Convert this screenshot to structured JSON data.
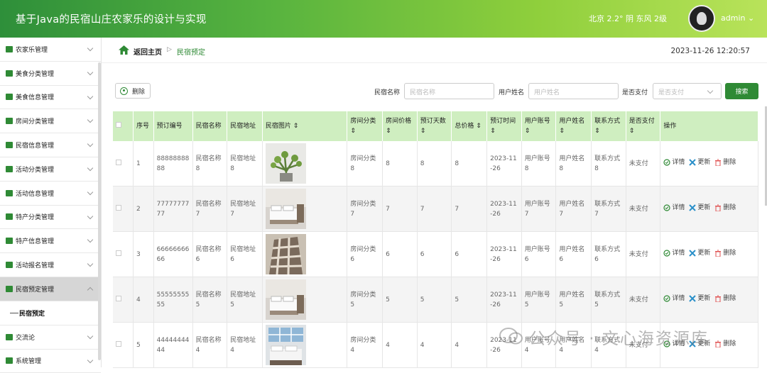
{
  "header": {
    "title": "基于Java的民宿山庄农家乐的设计与实现",
    "weather": "北京 2.2° 阴 东风 2级",
    "user": "admin ⌄"
  },
  "sidebar": {
    "items": [
      {
        "label": "农家乐管理",
        "icon": "check-icon"
      },
      {
        "label": "美食分类管理",
        "icon": "grid-icon"
      },
      {
        "label": "美食信息管理",
        "icon": "grid-icon"
      },
      {
        "label": "房间分类管理",
        "icon": "flag-icon"
      },
      {
        "label": "民宿信息管理",
        "icon": "chat-icon"
      },
      {
        "label": "活动分类管理",
        "icon": "card-icon"
      },
      {
        "label": "活动信息管理",
        "icon": "grid-icon"
      },
      {
        "label": "特产分类管理",
        "icon": "person-icon"
      },
      {
        "label": "特产信息管理",
        "icon": "pen-icon"
      },
      {
        "label": "活动报名管理",
        "icon": "grid-icon"
      },
      {
        "label": "民宿预定管理",
        "icon": "grid-icon",
        "open": true
      },
      {
        "label": "交流论",
        "icon": "chat-icon"
      },
      {
        "label": "系统管理",
        "icon": "grid-icon"
      }
    ],
    "sub_item": "民宿预定"
  },
  "breadcrumb": {
    "home": "返回主页",
    "sep": "▷",
    "current": "民宿预定"
  },
  "clock": "2023-11-26 12:20:57",
  "toolbar": {
    "delete": "删除",
    "search": "搜索"
  },
  "filters": [
    {
      "label": "民宿名称",
      "placeholder": "民宿名称"
    },
    {
      "label": "用户姓名",
      "placeholder": "用户姓名"
    },
    {
      "label": "是否支付",
      "placeholder": "是否支付"
    }
  ],
  "table": {
    "columns": [
      "",
      "序号",
      "预订编号",
      "民宿名称",
      "民宿地址",
      "民宿图片 ⇕",
      "房间分类 ⇕",
      "房间价格 ⇕",
      "预订天数 ⇕",
      "总价格 ⇕",
      "预订时间 ⇕",
      "用户账号 ⇕",
      "用户姓名 ⇕",
      "联系方式 ⇕",
      "是否支付 ⇕",
      "操作"
    ],
    "actions": [
      "详情",
      "更新",
      "删除"
    ],
    "rows": [
      {
        "idx": "1",
        "code": "8888888888",
        "name": "民宿名称8",
        "addr": "民宿地址8",
        "type": "房间分类8",
        "price": "8",
        "days": "8",
        "total": "8",
        "time": "2023-11-26",
        "acct": "用户账号8",
        "uname": "用户姓名8",
        "phone": "联系方式8",
        "paid": "未支付",
        "img": "plant"
      },
      {
        "idx": "2",
        "code": "7777777777",
        "name": "民宿名称7",
        "addr": "民宿地址7",
        "type": "房间分类7",
        "price": "7",
        "days": "7",
        "total": "7",
        "time": "2023-11-26",
        "acct": "用户账号7",
        "uname": "用户姓名7",
        "phone": "联系方式7",
        "paid": "未支付",
        "img": "bedroom"
      },
      {
        "idx": "3",
        "code": "6666666666",
        "name": "民宿名称6",
        "addr": "民宿地址6",
        "type": "房间分类6",
        "price": "6",
        "days": "6",
        "total": "6",
        "time": "2023-11-26",
        "acct": "用户账号6",
        "uname": "用户姓名6",
        "phone": "联系方式6",
        "paid": "未支付",
        "img": "blanket"
      },
      {
        "idx": "4",
        "code": "5555555555",
        "name": "民宿名称5",
        "addr": "民宿地址5",
        "type": "房间分类5",
        "price": "5",
        "days": "5",
        "total": "5",
        "time": "2023-11-26",
        "acct": "用户账号5",
        "uname": "用户姓名5",
        "phone": "联系方式5",
        "paid": "未支付",
        "img": "bedroom"
      },
      {
        "idx": "5",
        "code": "4444444444",
        "name": "民宿名称4",
        "addr": "民宿地址4",
        "type": "房间分类4",
        "price": "4",
        "days": "4",
        "total": "4",
        "time": "2023-11-26",
        "acct": "用户账号4",
        "uname": "用户姓名4",
        "phone": "联系方式4",
        "paid": "未支付",
        "img": "window"
      }
    ]
  },
  "watermark": "公众号 · 文心海资源库",
  "colors": {
    "accent": "#2f8a35",
    "header_bg": "#cfeec0"
  }
}
